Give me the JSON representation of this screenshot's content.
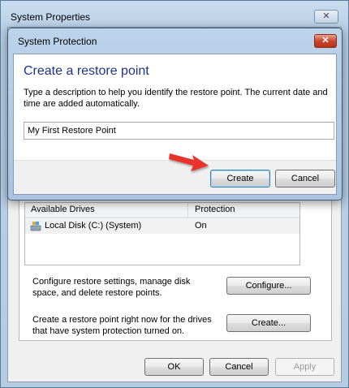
{
  "background_window": {
    "title": "System Properties",
    "close_glyph": "✕",
    "drives_table": {
      "headers": [
        "Available Drives",
        "Protection"
      ],
      "rows": [
        {
          "drive": "Local Disk (C:) (System)",
          "protection": "On",
          "icon": "hard-drive-icon"
        }
      ]
    },
    "configure_text": "Configure restore settings, manage disk space, and delete restore points.",
    "configure_button": "Configure...",
    "create_text": "Create a restore point right now for the drives that have system protection turned on.",
    "create_button": "Create...",
    "ok_button": "OK",
    "cancel_button": "Cancel",
    "apply_button": "Apply"
  },
  "dialog": {
    "title": "System Protection",
    "close_glyph": "✕",
    "heading": "Create a restore point",
    "instructions": "Type a description to help you identify the restore point. The current date and time are added automatically.",
    "description_value": "My First Restore Point",
    "create_button": "Create",
    "cancel_button": "Cancel"
  },
  "colors": {
    "heading": "#1e3287",
    "annotation_arrow": "#e8332a",
    "close_button": "#c9472f"
  }
}
